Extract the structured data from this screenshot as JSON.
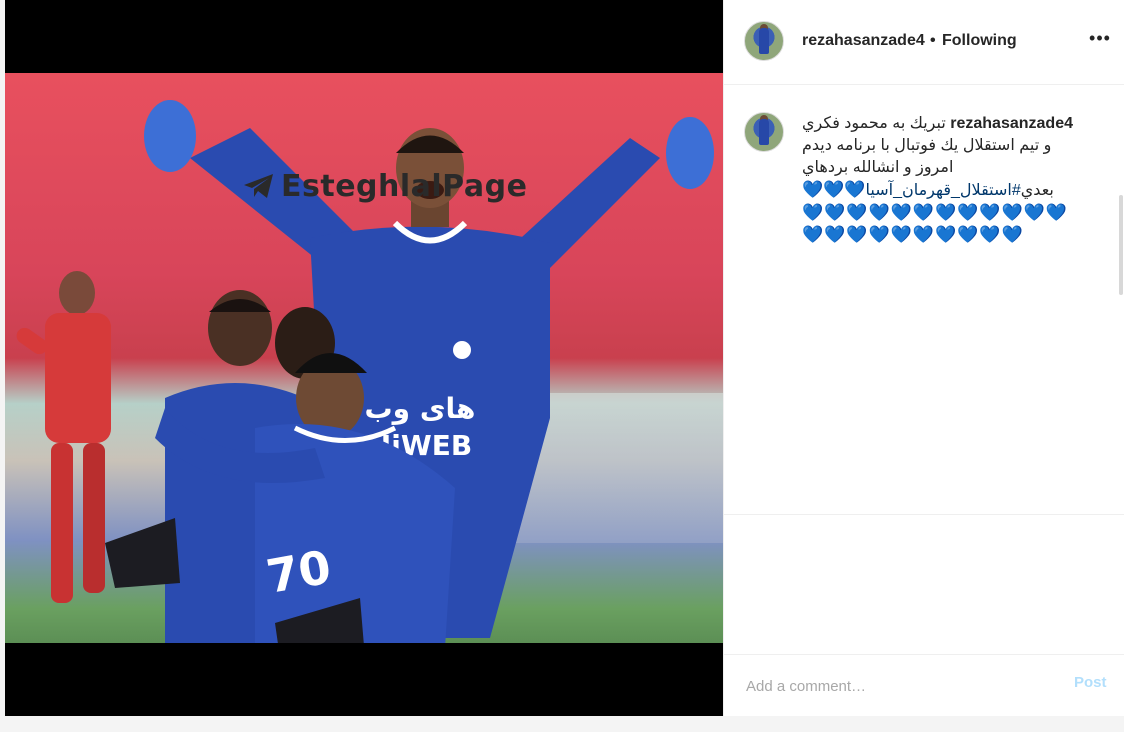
{
  "media": {
    "watermark_text": "EsteghlalPage",
    "jersey_sponsor_fa": "های وب",
    "jersey_sponsor_en": "HiWEB",
    "jersey_number": "70"
  },
  "header": {
    "username": "rezahasanzade4",
    "separator": "•",
    "follow_status": "Following",
    "more_icon": "ellipsis-icon"
  },
  "caption": {
    "username": "rezahasanzade4",
    "line1": "تبريك به محمود فكري",
    "line2": "و تيم استقلال يك فوتبال با برنامه ديدم",
    "line3": "امروز و انشالله بردهاي",
    "line4_text": "بعدي",
    "hashtag": "#استقلال_قهرمان_آسيا",
    "hearts_line1": "💙💙💙",
    "hearts_line2": "💙💙💙💙💙💙💙💙💙💙💙💙",
    "hearts_line3": "💙💙💙💙💙💙💙💙💙💙"
  },
  "comment_box": {
    "placeholder": "Add a comment…",
    "post_label": "Post"
  },
  "colors": {
    "accent_blue": "#0095f6",
    "post_disabled": "#b2dffc",
    "heart": "#1da7e6",
    "jersey": "#2a4bb0"
  }
}
